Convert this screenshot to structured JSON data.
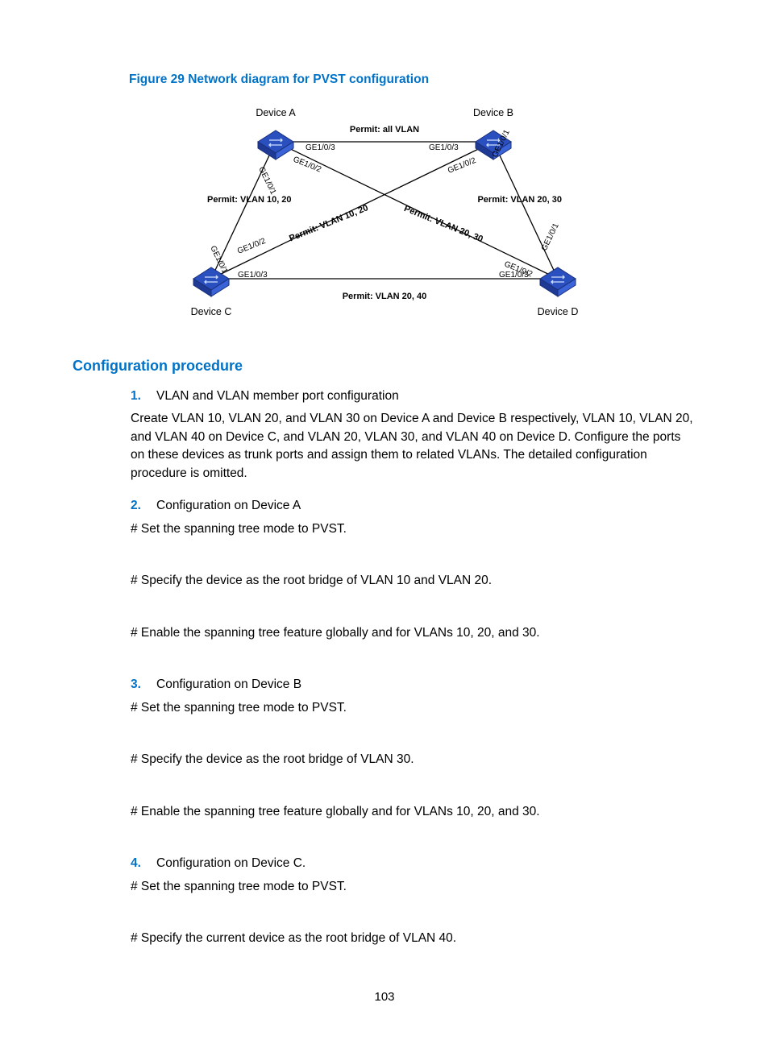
{
  "figure_title": "Figure 29 Network diagram for PVST configuration",
  "section_title": "Configuration procedure",
  "diagram": {
    "devices": {
      "A": "Device A",
      "B": "Device B",
      "C": "Device C",
      "D": "Device D"
    },
    "permits": {
      "top": "Permit: all VLAN",
      "left": "Permit: VLAN 10, 20",
      "right": "Permit: VLAN 20, 30",
      "diag_left": "Permit: VLAN 10, 20",
      "diag_right": "Permit: VLAN 20, 30",
      "bottom": "Permit: VLAN 20,  40"
    },
    "ports": {
      "ge101": "GE1/0/1",
      "ge102": "GE1/0/2",
      "ge103": "GE1/0/3"
    }
  },
  "list": {
    "1": {
      "num": "1.",
      "text": "VLAN and VLAN member port configuration"
    },
    "2": {
      "num": "2.",
      "text": "Configuration on Device A"
    },
    "3": {
      "num": "3.",
      "text": "Configuration on Device B"
    },
    "4": {
      "num": "4.",
      "text": "Configuration on Device C."
    }
  },
  "paras": {
    "intro": "Create VLAN 10, VLAN 20, and VLAN 30 on Device A and Device B respectively, VLAN 10, VLAN 20, and VLAN 40 on Device C, and VLAN 20, VLAN 30, and VLAN 40 on Device D. Configure the ports on these devices as trunk ports and assign them to related VLANs. The detailed configuration procedure is omitted.",
    "a1": "# Set the spanning tree mode to PVST.",
    "a2": "# Specify the device as the root bridge of VLAN 10 and VLAN 20.",
    "a3": "# Enable the spanning tree feature globally and for VLANs 10, 20, and 30.",
    "b1": "# Set the spanning tree mode to PVST.",
    "b2": "# Specify the device as the root bridge of VLAN 30.",
    "b3": "# Enable the spanning tree feature globally and for VLANs 10, 20, and 30.",
    "c1": "# Set the spanning tree mode to PVST.",
    "c2": "# Specify the current device as the root bridge of VLAN 40."
  },
  "page_number": "103"
}
